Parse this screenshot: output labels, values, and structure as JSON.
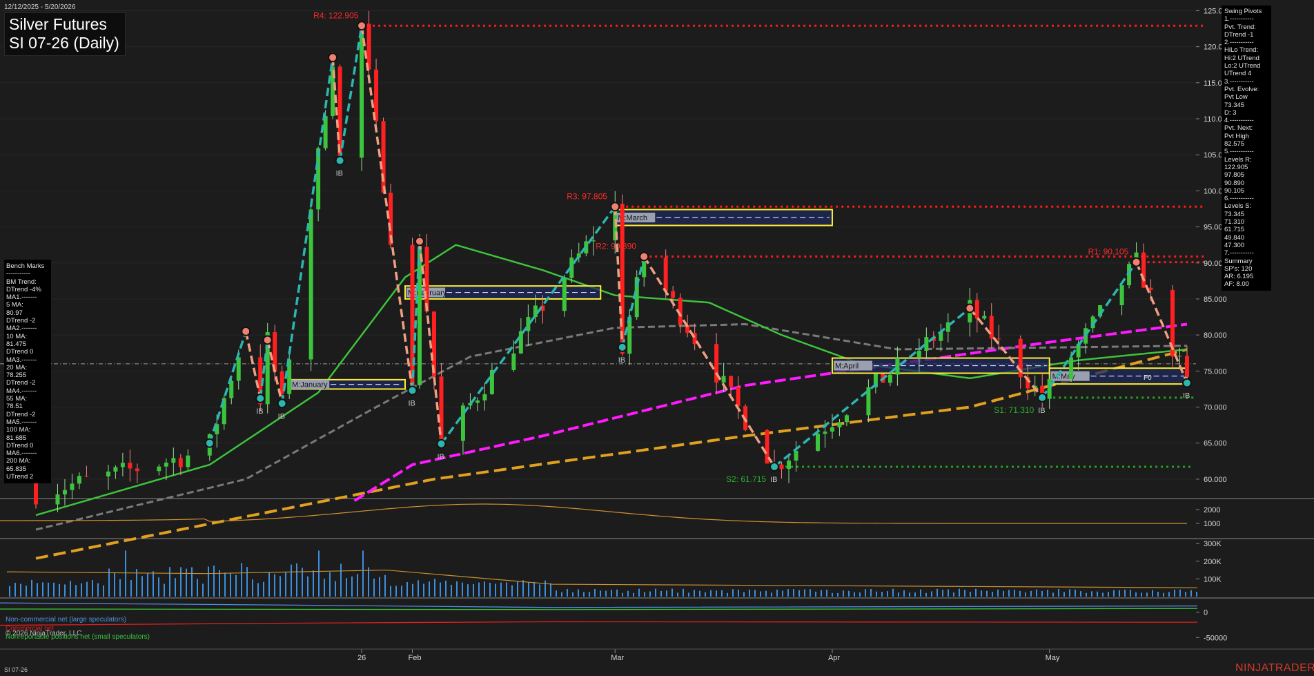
{
  "header": {
    "date_range": "12/12/2025 - 5/20/2026",
    "title_line1": "Silver Futures",
    "title_line2": "SI 07-26 (Daily)"
  },
  "benchmarks": {
    "lines": [
      "Bench Marks",
      "-----------",
      "BM Trend:",
      "DTrend -4%",
      "MA1.-------",
      "5 MA:",
      "80.97",
      "DTrend -2",
      "MA2.-------",
      "10 MA:",
      "81.475",
      "DTrend 0",
      "MA3.-------",
      "20 MA:",
      "78.255",
      "DTrend -2",
      "MA4.-------",
      "55 MA:",
      "78.51",
      "DTrend -2",
      "MA5.-------",
      "100 MA:",
      "81.685",
      "DTrend 0",
      "MA6.-------",
      "200 MA:",
      "65.835",
      "UTrend 2"
    ]
  },
  "swing_pivots": {
    "lines": [
      "Swing Pivots",
      "1.-----------",
      "Pvt. Trend:",
      "DTrend -1",
      "2.-----------",
      "HiLo Trend:",
      "Hi:2 UTrend",
      "Lo:2 UTrend",
      "UTrend 4",
      "3.-----------",
      "Pvt. Evolve:",
      "Pvt Low",
      "73.345",
      "D: 3",
      "4.-----------",
      "Pvt. Next:",
      "Pvt High",
      "82.575",
      "5.-----------",
      "Levels R:",
      "122.905",
      "97.805",
      "90.890",
      "90.105",
      "6.-----------",
      "Levels S:",
      "73.345",
      "71.310",
      "61.715",
      "49.840",
      "47.300",
      "7.-----------",
      "Summary",
      "SP's: 120",
      "AR: 6.195",
      "AF: 8.00"
    ]
  },
  "cot_legend": {
    "noncommercial": "Non-commercial net (large speculators)",
    "commercial": "Commercial net",
    "nonreportable": "Nonreportable positions net (small speculators)"
  },
  "copyright": "© 2026 NinjaTrader, LLC",
  "footer_symbol": "SI 07-26",
  "brand": "NINJATRADER",
  "colors": {
    "background": "#1c1c1c",
    "up_bar": "#3cc43c",
    "down_bar": "#ff2020",
    "resistance": "#ff1a1a",
    "support": "#1fa51f",
    "swing_up": "#2bb6b0",
    "swing_down": "#f0a080",
    "ma_magenta": "#ff1aff",
    "ma_green": "#3cc43c",
    "ma_gray": "#7a7a7a",
    "ma_orange": "#e0a020",
    "volume": "#3b8fe0"
  },
  "chart_data": [
    {
      "type": "candlestick",
      "title": "SI 07-26 (Daily)",
      "x_labels": [
        "26",
        "Feb",
        "Mar",
        "Apr",
        "May"
      ],
      "x_dates": [
        "2026-01-26",
        "2026-02-02",
        "2026-03-02",
        "2026-04-01",
        "2026-05-01"
      ],
      "ylim": [
        57.5,
        126
      ],
      "y_ticks": [
        60,
        65,
        70,
        75,
        80,
        85,
        90,
        95,
        100,
        105,
        110,
        115,
        120,
        125
      ],
      "y_tick_labels": [
        "60.000",
        "65.000",
        "70.000",
        "75.000",
        "80.000",
        "85.000",
        "90.000",
        "95.000",
        "100.000",
        "105.000",
        "110.000",
        "115.000",
        "120.000",
        "125.000"
      ],
      "last_price": 76.0,
      "resistance_levels": [
        {
          "label": "R4: 122.905",
          "value": 122.905
        },
        {
          "label": "R3: 97.805",
          "value": 97.805
        },
        {
          "label": "R2: 90.890",
          "value": 90.89
        },
        {
          "label": "R1: 90.105",
          "value": 90.105
        }
      ],
      "support_levels": [
        {
          "label": "S1: 71.310",
          "value": 71.31
        },
        {
          "label": "S2: 61.715",
          "value": 61.715
        }
      ],
      "monthly_boxes": [
        {
          "label": "M:January",
          "low": 72.5,
          "high": 73.8
        },
        {
          "label": "M:February",
          "low": 85.0,
          "high": 86.8
        },
        {
          "label": "M:March",
          "low": 95.2,
          "high": 97.4
        },
        {
          "label": "M:April",
          "low": 74.7,
          "high": 76.8
        },
        {
          "label": "M:May",
          "low": 73.2,
          "high": 75.4
        }
      ],
      "swing_pivots": [
        {
          "date": "2026-01-05",
          "price": 65.0
        },
        {
          "date": "2026-01-10",
          "price": 80.5
        },
        {
          "date": "2026-01-12",
          "price": 71.2
        },
        {
          "date": "2026-01-13",
          "price": 79.3
        },
        {
          "date": "2026-01-15",
          "price": 70.5
        },
        {
          "date": "2026-01-22",
          "price": 118.5
        },
        {
          "date": "2026-01-23",
          "price": 104.2
        },
        {
          "date": "2026-01-26",
          "price": 122.905
        },
        {
          "date": "2026-02-02",
          "price": 72.3
        },
        {
          "date": "2026-02-03",
          "price": 93.0
        },
        {
          "date": "2026-02-06",
          "price": 64.9
        },
        {
          "date": "2026-03-02",
          "price": 97.805
        },
        {
          "date": "2026-03-03",
          "price": 78.3
        },
        {
          "date": "2026-03-06",
          "price": 90.89
        },
        {
          "date": "2026-03-24",
          "price": 61.715
        },
        {
          "date": "2026-04-20",
          "price": 83.7
        },
        {
          "date": "2026-04-30",
          "price": 71.31
        },
        {
          "date": "2026-05-13",
          "price": 90.105
        },
        {
          "date": "2026-05-20",
          "price": 73.345
        }
      ],
      "pattern_labels": [
        "IB",
        "F0"
      ],
      "moving_averages": [
        {
          "name": "20 MA",
          "color": "green"
        },
        {
          "name": "55 MA",
          "color": "gray"
        },
        {
          "name": "100 MA",
          "color": "magenta"
        },
        {
          "name": "200 MA",
          "color": "orange"
        }
      ]
    },
    {
      "type": "line",
      "y_ticks": [
        1000,
        2000
      ],
      "y_tick_labels": [
        "1000",
        "2000"
      ]
    },
    {
      "type": "bar",
      "y_ticks": [
        100000,
        200000,
        300000
      ],
      "y_tick_labels": [
        "100K",
        "200K",
        "300K"
      ]
    },
    {
      "type": "line",
      "y_ticks": [
        0,
        -50000
      ],
      "y_tick_labels": [
        "0",
        "-50000"
      ],
      "series": [
        {
          "name": "Non-commercial net (large speculators)",
          "color": "#4f8fe0"
        },
        {
          "name": "Commercial net",
          "color": "#e02020"
        },
        {
          "name": "Nonreportable positions net (small speculators)",
          "color": "#3cc43c"
        }
      ]
    }
  ]
}
